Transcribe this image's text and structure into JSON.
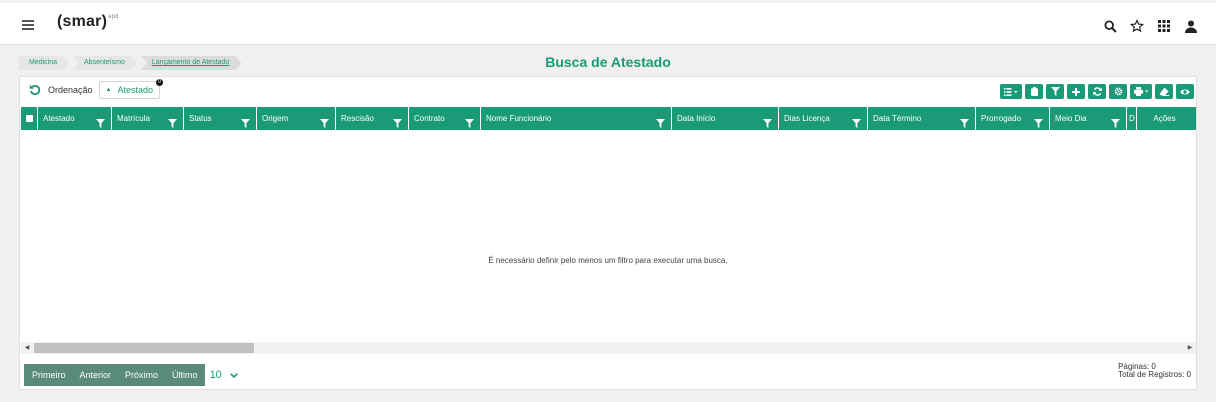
{
  "header": {
    "logo_text": "(smar)",
    "logo_sup": "apd",
    "icons": [
      "search-icon",
      "star-icon",
      "apps-grid-icon",
      "user-icon"
    ]
  },
  "breadcrumb": {
    "items": [
      {
        "label": "Medicina"
      },
      {
        "label": "Absenteísmo"
      },
      {
        "label": "Lançamento de Atestado"
      }
    ]
  },
  "page": {
    "title": "Busca de Atestado"
  },
  "sort": {
    "label": "Ordenação",
    "chip_label": "Atestado",
    "chip_badge": "0"
  },
  "toolbar": {
    "buttons": [
      "list-icon",
      "clipboard-icon",
      "filter-icon",
      "plus-icon",
      "refresh-icon",
      "gear-icon",
      "print-icon",
      "eraser-icon",
      "eye-icon"
    ]
  },
  "table": {
    "columns": [
      {
        "label": "Atestado"
      },
      {
        "label": "Matrícula"
      },
      {
        "label": "Status"
      },
      {
        "label": "Origem"
      },
      {
        "label": "Rescisão"
      },
      {
        "label": "Contrato"
      },
      {
        "label": "Nome Funcionário"
      },
      {
        "label": "Data Início"
      },
      {
        "label": "Dias Licença"
      },
      {
        "label": "Data Término"
      },
      {
        "label": "Prorrogado"
      },
      {
        "label": "Meio Dia"
      },
      {
        "label": "D"
      },
      {
        "label": "Ações"
      }
    ],
    "empty_message": "É necessário definir pelo menos um filtro para executar uma busca."
  },
  "pager": {
    "first": "Primeiro",
    "previous": "Anterior",
    "next": "Próximo",
    "last": "Último",
    "page_size": "10"
  },
  "stats": {
    "pages": "Páginas: 0",
    "total": "Total de Registros: 0"
  },
  "colors": {
    "accent": "#1a9a76",
    "pager": "#5a8a7a"
  }
}
